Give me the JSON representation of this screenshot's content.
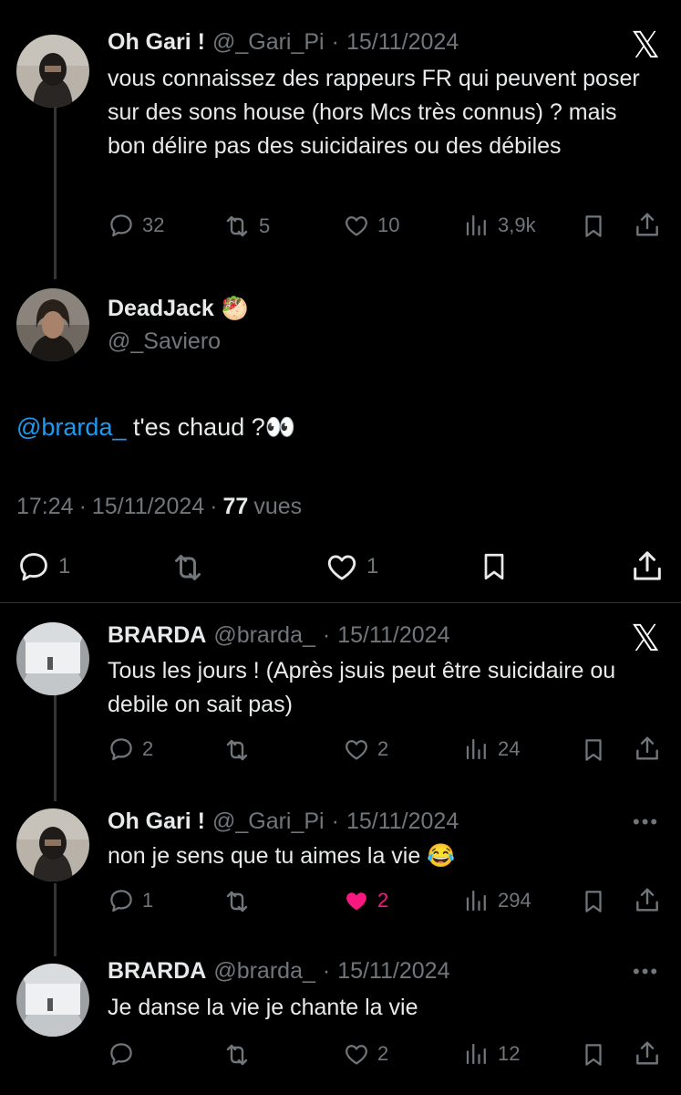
{
  "thread": {
    "tweet1": {
      "name": "Oh Gari !",
      "handle": "@_Gari_Pi",
      "sep": "·",
      "date": "15/11/2024",
      "text": "vous connaissez des rappeurs FR qui peuvent poser sur des sons house (hors Mcs très connus) ? mais bon délire pas des suicidaires ou des débiles",
      "replies": "32",
      "retweets": "5",
      "likes": "10",
      "views": "3,9k"
    },
    "main": {
      "name": "DeadJack",
      "name_emoji": "🥙",
      "handle": "@_Saviero",
      "mention": "@brarda_",
      "text": " t'es chaud ?👀",
      "time": "17:24",
      "date": "15/11/2024",
      "views_count": "77",
      "views_label": "vues",
      "replies": "1",
      "likes": "1"
    },
    "tweet3": {
      "name": "BRARDA",
      "handle": "@brarda_",
      "sep": "·",
      "date": "15/11/2024",
      "text": "Tous les jours ! (Après jsuis peut être suicidaire ou debile on sait pas)",
      "replies": "2",
      "likes": "2",
      "views": "24"
    },
    "tweet4": {
      "name": "Oh Gari !",
      "handle": "@_Gari_Pi",
      "sep": "·",
      "date": "15/11/2024",
      "text": "non je sens que tu aimes la vie 😂",
      "replies": "1",
      "likes": "2",
      "views": "294"
    },
    "tweet5": {
      "name": "BRARDA",
      "handle": "@brarda_",
      "sep": "·",
      "date": "15/11/2024",
      "text": "Je danse la vie je chante la vie",
      "likes": "2",
      "views": "12"
    }
  },
  "icons": {
    "x_logo": "𝕏",
    "more": "•••"
  },
  "colors": {
    "like_active": "#f91880",
    "mention": "#1d9bf0",
    "muted": "#71767b"
  }
}
